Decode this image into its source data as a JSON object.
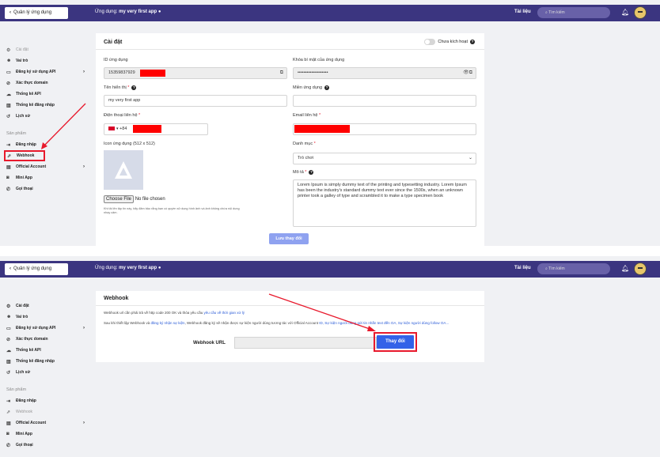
{
  "topbar": {
    "back_label": "Quản lý ứng dụng",
    "app_prefix": "Ứng dụng: ",
    "app_name": "my very first app",
    "status_dot": "●",
    "docs_label": "Tài liệu",
    "search_placeholder": "Tìm kiếm"
  },
  "sidebar": {
    "items": [
      {
        "icon": "⚙",
        "label": "Cài đặt"
      },
      {
        "icon": "☻",
        "label": "Vai trò"
      },
      {
        "icon": "▭",
        "label": "Đăng ký sử dụng API",
        "arrow": "›"
      },
      {
        "icon": "⊘",
        "label": "Xác thực domain"
      },
      {
        "icon": "☁",
        "label": "Thống kê API"
      },
      {
        "icon": "▥",
        "label": "Thống kê đăng nhập"
      },
      {
        "icon": "↺",
        "label": "Lịch sử"
      }
    ],
    "section_label": "Sản phẩm",
    "products": [
      {
        "icon": "⇥",
        "label": "Đăng nhập"
      },
      {
        "icon": "⇗",
        "label": "Webhook"
      },
      {
        "icon": "▤",
        "label": "Official Account",
        "arrow": "›"
      },
      {
        "icon": "◙",
        "label": "Mini App"
      },
      {
        "icon": "✆",
        "label": "Gọi thoại"
      }
    ]
  },
  "settings": {
    "title": "Cài đặt",
    "inactive_label": "Chưa kích hoạt",
    "app_id_label": "ID ứng dụng",
    "app_id_value": "15359837929",
    "secret_label": "Khóa bí mật của ứng dụng",
    "secret_value": "••••••••••••••••••••",
    "display_name_label": "Tên hiển thị",
    "display_name_value": "my very first app",
    "domain_label": "Miền ứng dụng",
    "phone_label": "Điện thoại liên hệ",
    "phone_prefix": "+84",
    "email_label": "Email liên hệ",
    "icon_label": "Icon ứng dụng (512 x 512)",
    "file_button": "Choose File",
    "file_status": "No file chosen",
    "hint": "Khi tải lên tập tin này, hãy đảm bảo rằng bạn có quyền sử dụng hình ảnh và ảnh không chứa nội dung nhạy cảm.",
    "category_label": "Danh mục",
    "category_value": "Trò chơi",
    "description_label": "Mô tả",
    "description_value": "Lorem Ipsum is simply dummy text of the printing and typesetting industry. Lorem Ipsum has been the industry's standard dummy text ever since the 1500s, when an unknown printer took a galley of type and scrambled it to make a type specimen book",
    "save_button": "Lưu thay đổi"
  },
  "webhook": {
    "title": "Webhook",
    "line1_a": "Webhook url cần phải trả về http code 200 OK và thỏa yêu cầu ",
    "line1_link": "yêu cầu về thời gian xử lý",
    "line2_a": "Sau khi thiết lập Webhook và ",
    "line2_link1": "đăng ký nhận sự kiện",
    "line2_b": ", Webhook đăng ký sẽ nhận được sự kiện người dùng tương tác với Official Account ",
    "line2_link2": "ID, Sự kiện người dùng gửi tin nhắn text đến OA, Sự kiện người dùng follow OA...",
    "url_label": "Webhook URL",
    "change_button": "Thay đổi"
  },
  "colors": {
    "topbar": "#3b3580",
    "accent": "#3362e8",
    "highlight": "#e8192c"
  }
}
